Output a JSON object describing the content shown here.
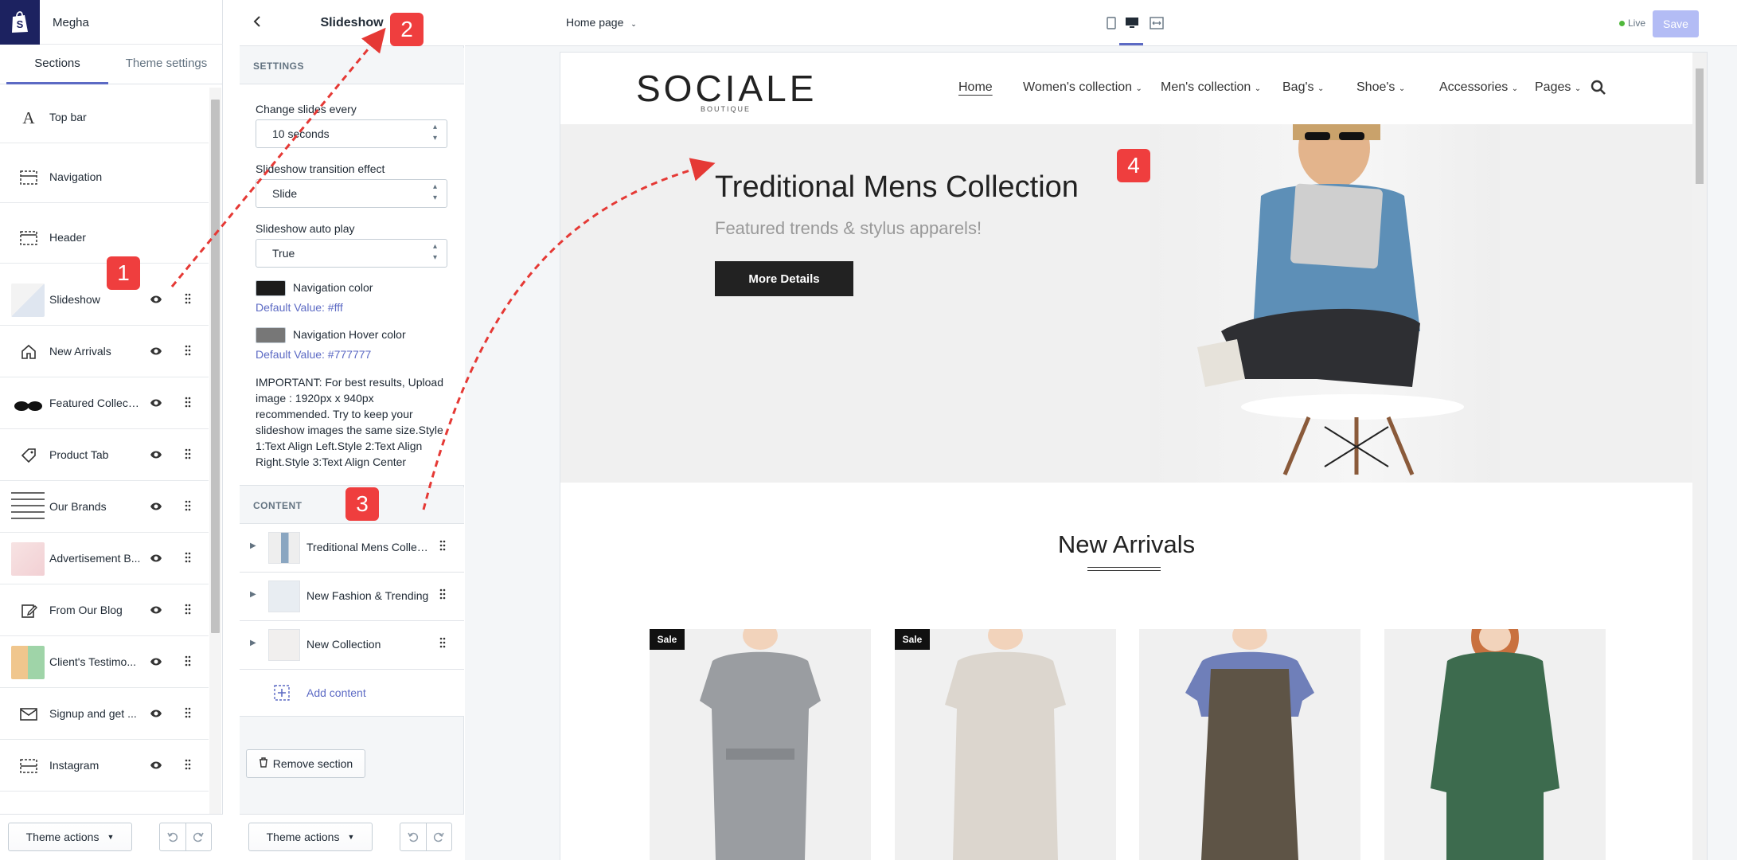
{
  "app": {
    "store_name": "Megha"
  },
  "left_panel": {
    "tabs": [
      {
        "label": "Sections"
      },
      {
        "label": "Theme settings"
      }
    ],
    "sections": [
      {
        "label": "Top bar",
        "icon": "font-a-icon"
      },
      {
        "label": "Navigation",
        "icon": "navigation-layout-icon"
      },
      {
        "label": "Header",
        "icon": "header-layout-icon"
      },
      {
        "label": "Slideshow",
        "icon": "thumbnail"
      },
      {
        "label": "New Arrivals",
        "icon": "home-icon"
      },
      {
        "label": "Featured Collecti...",
        "icon": "thumbnail"
      },
      {
        "label": "Product Tab",
        "icon": "tag-icon"
      },
      {
        "label": "Our Brands",
        "icon": "thumbnail"
      },
      {
        "label": "Advertisement B...",
        "icon": "thumbnail"
      },
      {
        "label": "From Our Blog",
        "icon": "edit-icon"
      },
      {
        "label": "Client's Testimo...",
        "icon": "thumbnail"
      },
      {
        "label": "Signup and get ...",
        "icon": "mail-icon"
      },
      {
        "label": "Instagram",
        "icon": "instagram-layout-icon"
      }
    ],
    "theme_actions_label": "Theme actions"
  },
  "middle_panel": {
    "title": "Slideshow",
    "settings_heading": "SETTINGS",
    "change_slides_label": "Change slides every",
    "change_slides_value": "10 seconds",
    "transition_label": "Slideshow transition effect",
    "transition_value": "Slide",
    "autoplay_label": "Slideshow auto play",
    "autoplay_value": "True",
    "nav_color_label": "Navigation color",
    "nav_color_default": "Default Value: #fff",
    "nav_color_swatch": "#1c1c1c",
    "nav_hover_label": "Navigation Hover color",
    "nav_hover_default": "Default Value: #777777",
    "nav_hover_swatch": "#777777",
    "important_text": "IMPORTANT: For best results, Upload image : 1920px x 940px recommended. Try to keep your slideshow images the same size.Style 1:Text Align Left.Style 2:Text Align Right.Style 3:Text Align Center",
    "content_heading": "CONTENT",
    "content_items": [
      {
        "label": "Treditional Mens Collec..."
      },
      {
        "label": "New Fashion & Trending"
      },
      {
        "label": "New Collection"
      }
    ],
    "add_content_label": "Add content",
    "remove_section_label": "Remove section",
    "theme_actions_label": "Theme actions"
  },
  "preview": {
    "page_select": "Home page",
    "live_label": "Live",
    "save_label": "Save",
    "accent": "#5c6ac4",
    "site": {
      "brand": "SOCIALE",
      "brand_sub": "BOUTIQUE",
      "nav": [
        "Home",
        "Women's collection",
        "Men's collection",
        "Bag's",
        "Shoe's",
        "Accessories",
        "Pages"
      ],
      "hero_title": "Treditional Mens Collection",
      "hero_subtitle": "Featured trends & stylus apparels!",
      "hero_button": "More Details",
      "new_arrivals_title": "New Arrivals",
      "products": [
        {
          "badge": "Sale"
        },
        {
          "badge": "Sale"
        },
        {
          "badge": ""
        },
        {
          "badge": ""
        }
      ]
    }
  },
  "annotations": [
    "1",
    "2",
    "3",
    "4"
  ]
}
